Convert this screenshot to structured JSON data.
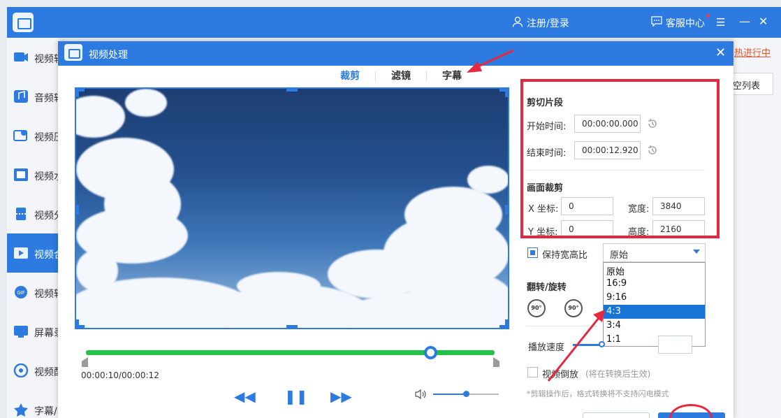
{
  "app": {
    "login_label": "注册/登录",
    "service_label": "客服中心",
    "user_icon": "user-icon",
    "chat_icon": "chat-icon",
    "menu_icon": "☰",
    "minimize_icon": "—",
    "close_icon": "✕"
  },
  "sidebar": {
    "items": [
      {
        "label": "视频转",
        "icon": "video-convert-icon"
      },
      {
        "label": "音频转",
        "icon": "audio-convert-icon"
      },
      {
        "label": "视频压",
        "icon": "video-compress-icon"
      },
      {
        "label": "视频水",
        "icon": "video-watermark-icon"
      },
      {
        "label": "视频分",
        "icon": "video-split-icon"
      },
      {
        "label": "视频合",
        "icon": "video-merge-icon",
        "active": true
      },
      {
        "label": "视频转",
        "icon": "gif-icon"
      },
      {
        "label": "屏幕录",
        "icon": "screen-record-icon"
      },
      {
        "label": "视频配",
        "icon": "video-dub-icon"
      },
      {
        "label": "字幕/",
        "icon": "subtitle-icon"
      }
    ]
  },
  "background": {
    "hot_progress": "热进行中",
    "empty_list": "空列表"
  },
  "dialog": {
    "title": "视频处理",
    "close_icon": "✕",
    "tabs": [
      {
        "label": "裁剪",
        "active": true
      },
      {
        "label": "滤镜",
        "active": false
      },
      {
        "label": "字幕",
        "active": false
      }
    ]
  },
  "player": {
    "time": "00:00:10/00:00:12",
    "progress": 0.82,
    "volume": 0.5,
    "rewind_icon": "◀◀",
    "pause_icon": "❚❚",
    "forward_icon": "▶▶"
  },
  "settings": {
    "clip_section": "剪切片段",
    "start_label": "开始时间:",
    "start_value": "00:00:00.000",
    "end_label": "结束时间:",
    "end_value": "00:00:12.920",
    "crop_section": "画面裁剪",
    "x_label": "X 坐标:",
    "x_value": "0",
    "y_label": "Y 坐标:",
    "y_value": "0",
    "width_label": "宽度:",
    "width_value": "3840",
    "height_label": "高度:",
    "height_value": "2160",
    "keep_ratio_label": "保持宽高比",
    "keep_ratio_checked": true,
    "ratio_selected": "原始",
    "ratio_options": [
      "原始",
      "16:9",
      "9:16",
      "4:3",
      "3:4",
      "1:1"
    ],
    "ratio_highlighted": "4:3",
    "flip_section": "翻转/旋转",
    "rotate_cw": "90°",
    "rotate_ccw": "90°",
    "speed_label": "播放速度",
    "reverse_label": "视频倒放",
    "reverse_note": "(将在转换后生效)",
    "footnote": "*剪辑操作后，格式转换将不支持闪电模式"
  },
  "colors": {
    "accent": "#2d7be0",
    "highlight_red": "#e5283d",
    "track_green": "#23c04a"
  }
}
